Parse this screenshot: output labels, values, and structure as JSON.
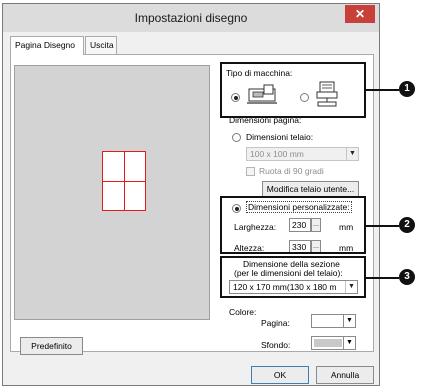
{
  "dialog": {
    "title": "Impostazioni disegno",
    "close_icon": "close-icon",
    "tabs": [
      {
        "label": "Pagina Disegno",
        "active": true
      },
      {
        "label": "Uscita",
        "active": false
      }
    ]
  },
  "machine_type": {
    "label": "Tipo di macchina:",
    "options": [
      {
        "icon": "embroidery-machine-icon",
        "selected": true
      },
      {
        "icon": "multi-needle-machine-icon",
        "selected": false
      }
    ]
  },
  "page_size": {
    "label": "Dimensioni pagina:",
    "hoop_size": {
      "label": "Dimensioni telaio:",
      "value": "100 x 100 mm",
      "rotate_label": "Ruota di 90 gradi",
      "modify_button": "Modifica telaio utente..."
    },
    "custom": {
      "label": "Dimensioni personalizzate:",
      "width_label": "Larghezza:",
      "width_value": "230",
      "height_label": "Altezza:",
      "height_value": "330",
      "unit": "mm"
    }
  },
  "section_size": {
    "label_line1": "Dimensione della sezione",
    "label_line2": "(per le dimensioni del telaio):",
    "value": "120 x 170 mm(130 x 180 m"
  },
  "colors": {
    "label": "Colore:",
    "page_label": "Pagina:",
    "background_label": "Sfondo:",
    "page_color": "#ffffff",
    "background_color": "#c9c9c9"
  },
  "buttons": {
    "default": "Predefinito",
    "ok": "OK",
    "cancel": "Annulla"
  },
  "callouts": [
    "1",
    "2",
    "3"
  ],
  "accent_colors": {
    "close": "#c7413a",
    "page_outline": "#e31b1b"
  }
}
